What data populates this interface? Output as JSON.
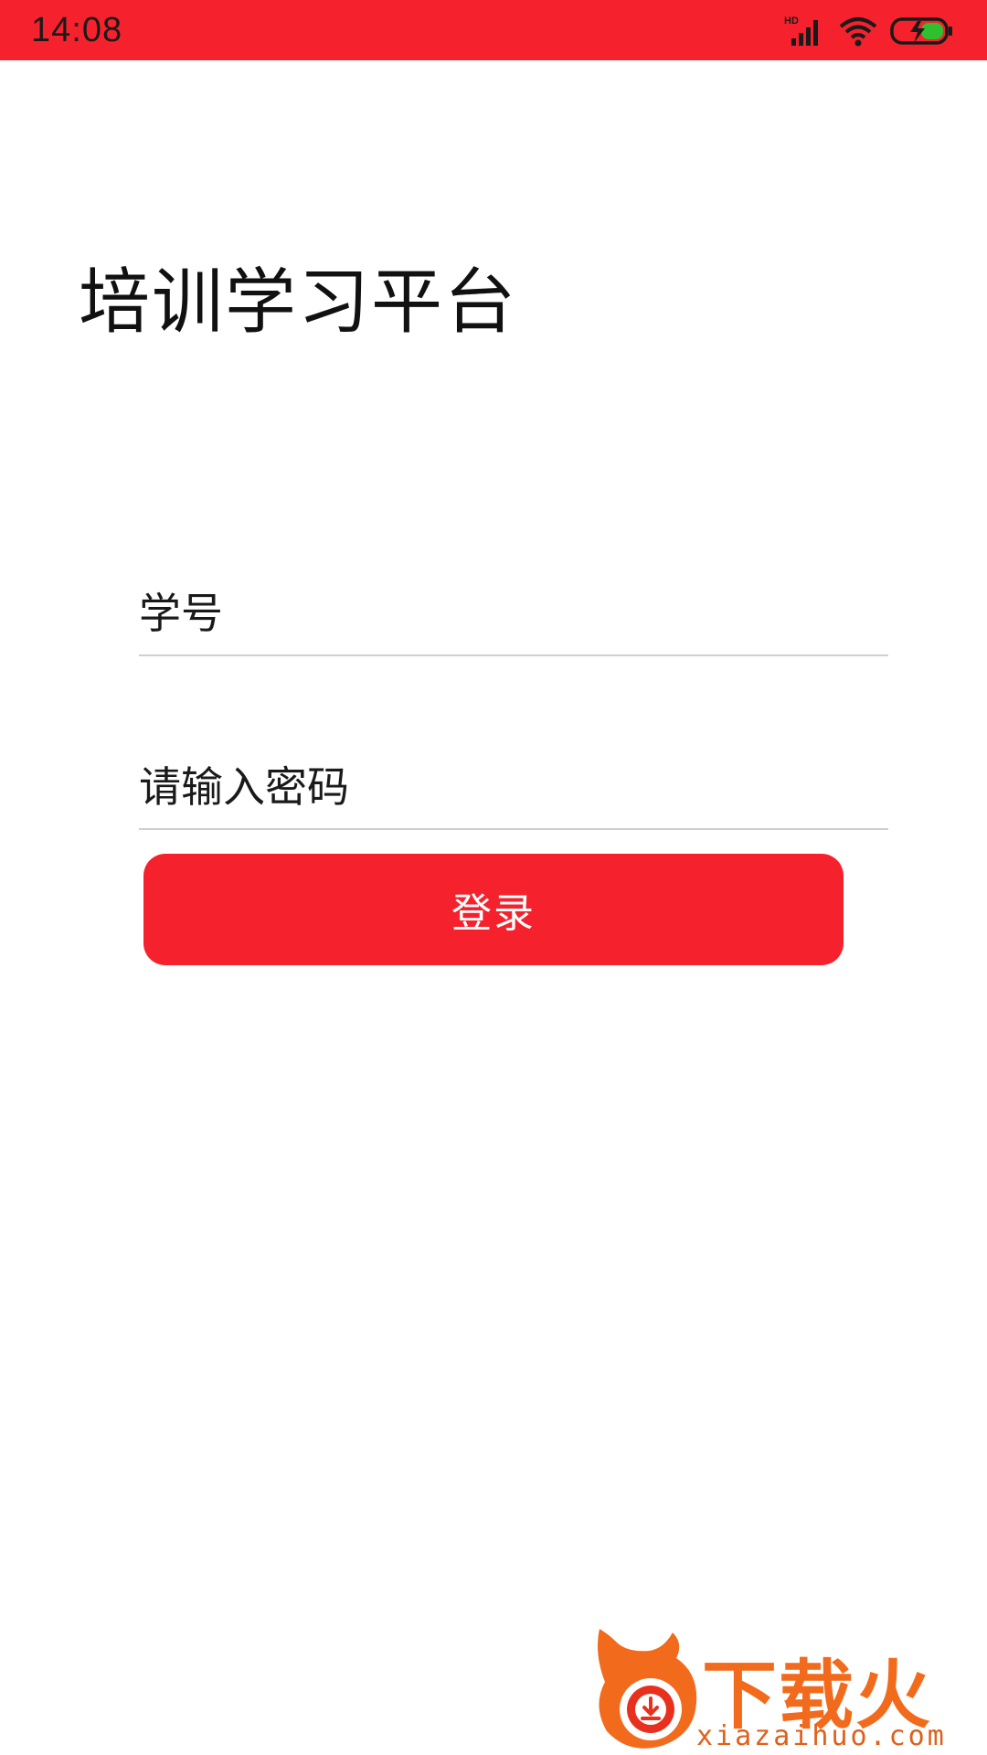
{
  "status_bar": {
    "time": "14:08",
    "icons": [
      "hd-signal-icon",
      "wifi-icon",
      "battery-charging-icon"
    ],
    "color": "#f5222d"
  },
  "page": {
    "title": "培训学习平台"
  },
  "form": {
    "id_placeholder": "学号",
    "password_placeholder": "请输入密码",
    "login_label": "登录",
    "accent": "#f5222d"
  },
  "watermark": {
    "brand": "下载火",
    "domain": "xiazaihuo.com",
    "color": "#f26a1b"
  }
}
